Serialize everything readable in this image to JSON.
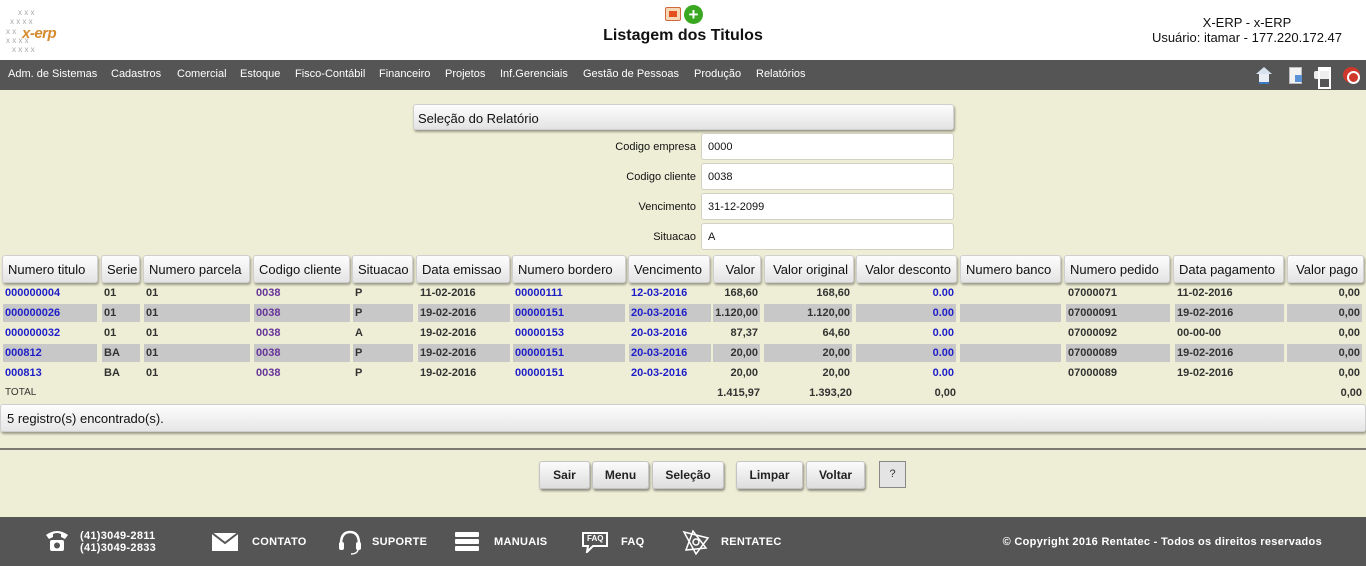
{
  "header": {
    "title": "Listagem dos Titulos",
    "logo_text": "x-erp",
    "system_name": "X-ERP - x-ERP",
    "user_line": "Usuário: itamar - 177.220.172.47"
  },
  "nav": {
    "items": [
      "Adm. de Sistemas",
      "Cadastros",
      "Comercial",
      "Estoque",
      "Fisco-Contábil",
      "Financeiro",
      "Projetos",
      "Inf.Gerenciais",
      "Gestão de Pessoas",
      "Produção",
      "Relatórios"
    ],
    "tools": [
      "home-icon",
      "document-icon",
      "print-icon",
      "exit-icon"
    ]
  },
  "selection": {
    "title": "Seleção do Relatório",
    "fields": [
      {
        "label": "Codigo empresa",
        "value": "0000"
      },
      {
        "label": "Codigo cliente",
        "value": "0038"
      },
      {
        "label": "Vencimento",
        "value": "31-12-2099"
      },
      {
        "label": "Situacao",
        "value": "A"
      }
    ]
  },
  "table": {
    "columns": [
      "Numero titulo",
      "Serie",
      "Numero parcela",
      "Codigo cliente",
      "Situacao",
      "Data emissao",
      "Numero bordero",
      "Vencimento",
      "Valor",
      "Valor original",
      "Valor desconto",
      "Numero banco",
      "Numero pedido",
      "Data pagamento",
      "Valor pago"
    ],
    "rows": [
      [
        "000000004",
        "01",
        "01",
        "0038",
        "P",
        "11-02-2016",
        "00000111",
        "12-03-2016",
        "168,60",
        "168,60",
        "0.00",
        "",
        "07000071",
        "11-02-2016",
        "0,00"
      ],
      [
        "000000026",
        "01",
        "01",
        "0038",
        "P",
        "19-02-2016",
        "00000151",
        "20-03-2016",
        "1.120,00",
        "1.120,00",
        "0.00",
        "",
        "07000091",
        "19-02-2016",
        "0,00"
      ],
      [
        "000000032",
        "01",
        "01",
        "0038",
        "A",
        "19-02-2016",
        "00000153",
        "20-03-2016",
        "87,37",
        "64,60",
        "0.00",
        "",
        "07000092",
        "00-00-00",
        "0,00"
      ],
      [
        "000812",
        "BA",
        "01",
        "0038",
        "P",
        "19-02-2016",
        "00000151",
        "20-03-2016",
        "20,00",
        "20,00",
        "0.00",
        "",
        "07000089",
        "19-02-2016",
        "0,00"
      ],
      [
        "000813",
        "BA",
        "01",
        "0038",
        "P",
        "19-02-2016",
        "00000151",
        "20-03-2016",
        "20,00",
        "20,00",
        "0.00",
        "",
        "07000089",
        "19-02-2016",
        "0,00"
      ]
    ],
    "total": {
      "label": "TOTAL",
      "valor": "1.415,97",
      "valor_original": "1.393,20",
      "valor_desconto": "0,00",
      "valor_pago": "0,00"
    },
    "records_msg": "5 registro(s) encontrado(s)."
  },
  "buttons": {
    "sair": "Sair",
    "menu": "Menu",
    "selecao": "Seleção",
    "limpar": "Limpar",
    "voltar": "Voltar",
    "help": "?"
  },
  "footer": {
    "phone1": "(41)3049-2811",
    "phone2": "(41)3049-2833",
    "contato": "CONTATO",
    "suporte": "SUPORTE",
    "manuais": "MANUAIS",
    "faq": "FAQ",
    "faq_icon_text": "FAQ",
    "rentatec": "RENTATEC",
    "copyright": "© Copyright 2016 Rentatec - Todos os direitos reservados"
  }
}
